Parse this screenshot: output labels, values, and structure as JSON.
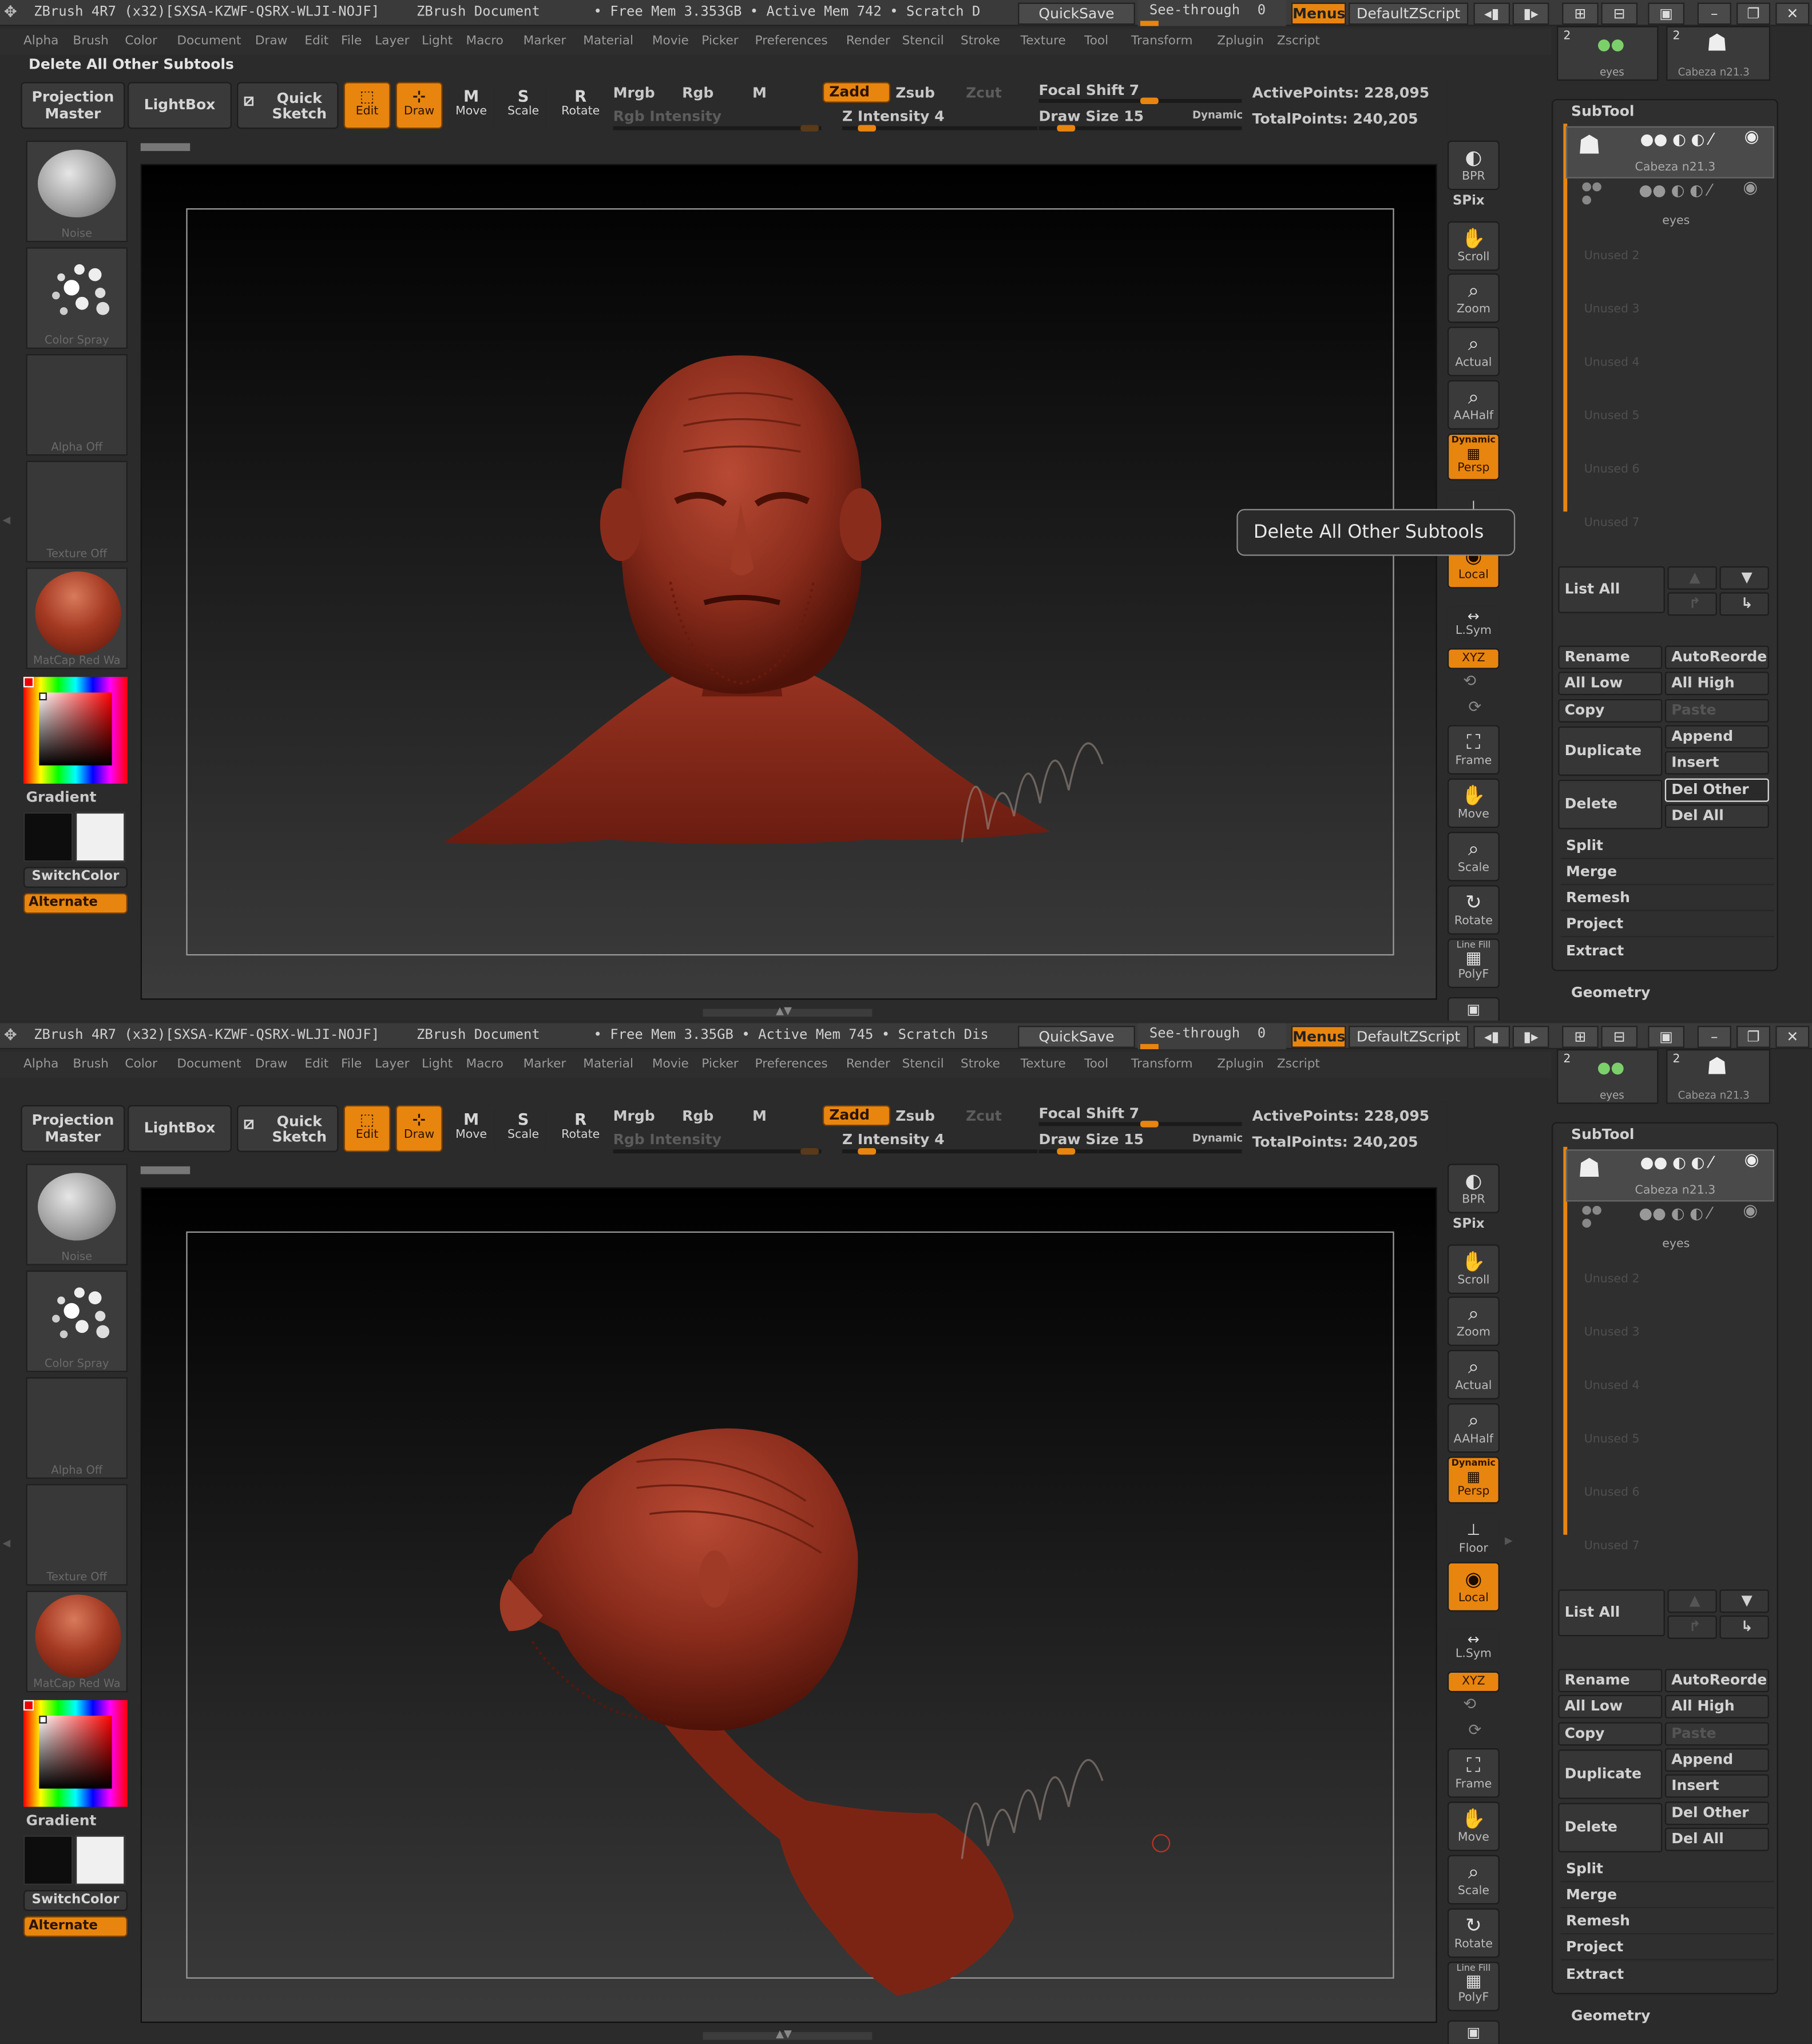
{
  "screens": [
    {
      "titlebar": {
        "app": "ZBrush 4R7 (x32)[SXSA-KZWF-QSRX-WLJI-NOJF]",
        "document": "ZBrush Document",
        "mem": "• Free Mem 3.353GB • Active Mem 742 • Scratch D",
        "quicksave": "QuickSave",
        "seethrough": "See-through",
        "seethrough_value": "0",
        "menus": "Menus",
        "script": "DefaultZScript"
      },
      "status_message": "Delete All Other Subtools",
      "tooltip": "Delete All Other Subtools",
      "active_points": "ActivePoints: 228,095",
      "total_points": "TotalPoints: 240,205"
    },
    {
      "titlebar": {
        "app": "ZBrush 4R7 (x32)[SXSA-KZWF-QSRX-WLJI-NOJF]",
        "document": "ZBrush Document",
        "mem": "• Free Mem 3.35GB • Active Mem 745 • Scratch Dis",
        "quicksave": "QuickSave",
        "seethrough": "See-through",
        "seethrough_value": "0",
        "menus": "Menus",
        "script": "DefaultZScript"
      },
      "status_message": "",
      "tooltip": "",
      "active_points": "ActivePoints: 228,095",
      "total_points": "TotalPoints: 240,205"
    }
  ],
  "menubar": [
    "Alpha",
    "Brush",
    "Color",
    "Document",
    "Draw",
    "Edit",
    "File",
    "Layer",
    "Light",
    "Macro",
    "Marker",
    "Material",
    "Movie",
    "Picker",
    "Preferences",
    "Render",
    "Stencil",
    "Stroke",
    "Texture",
    "Tool",
    "Transform",
    "Zplugin",
    "Zscript"
  ],
  "toolbar": {
    "projection_master": [
      "Projection",
      "Master"
    ],
    "lightbox": "LightBox",
    "quick_sketch": [
      "Quick",
      "Sketch"
    ],
    "edit": "Edit",
    "draw": "Draw",
    "move": "Move",
    "scale": "Scale",
    "rotate": "Rotate",
    "mrgb": "Mrgb",
    "rgb": "Rgb",
    "m": "M",
    "rgb_intensity": "Rgb Intensity",
    "zadd": "Zadd",
    "zsub": "Zsub",
    "zcut": "Zcut",
    "z_intensity": "Z Intensity 4",
    "focal_shift": "Focal Shift 7",
    "draw_size": "Draw Size 15",
    "dynamic": "Dynamic"
  },
  "left_panel": {
    "brush_caption": "Noise",
    "stroke_caption": "Color Spray",
    "alpha_caption": "Alpha Off",
    "texture_caption": "Texture Off",
    "material_caption": "MatCap Red Wa",
    "gradient": "Gradient",
    "switchcolor": "SwitchColor",
    "alternate": "Alternate"
  },
  "right_shelf": {
    "bpr": "BPR",
    "spix": "SPix",
    "scroll": "Scroll",
    "zoom": "Zoom",
    "actual": "Actual",
    "aahalf": "AAHalf",
    "dynamic": "Dynamic",
    "persp": "Persp",
    "floor": "Floor",
    "local": "Local",
    "lsym": "L.Sym",
    "xyz": "XYZ",
    "frame": "Frame",
    "move": "Move",
    "scale": "Scale",
    "rotate": "Rotate",
    "line_fill": "Line Fill",
    "polyf": "PolyF"
  },
  "top_thumbs": {
    "eyes": "eyes",
    "cabeza": "Cabeza n21.3",
    "count_a": "2",
    "count_b": "2"
  },
  "subtool": {
    "title": "SubTool",
    "items": [
      "Cabeza n21.3",
      "eyes"
    ],
    "unused": [
      "Unused 2",
      "Unused 3",
      "Unused 4",
      "Unused 5",
      "Unused 6",
      "Unused 7"
    ],
    "list_all": "List All",
    "rename": "Rename",
    "autoreorder": "AutoReorder",
    "all_low": "All Low",
    "all_high": "All High",
    "copy": "Copy",
    "paste": "Paste",
    "duplicate": "Duplicate",
    "append": "Append",
    "insert": "Insert",
    "delete": "Delete",
    "del_other": "Del Other",
    "del_all": "Del All",
    "split": "Split",
    "merge": "Merge",
    "remesh": "Remesh",
    "project": "Project",
    "extract": "Extract",
    "geometry": "Geometry"
  },
  "colors": {
    "accent": "#e8850f",
    "model": "#8a2c1c",
    "panel": "#2f2f2f"
  }
}
